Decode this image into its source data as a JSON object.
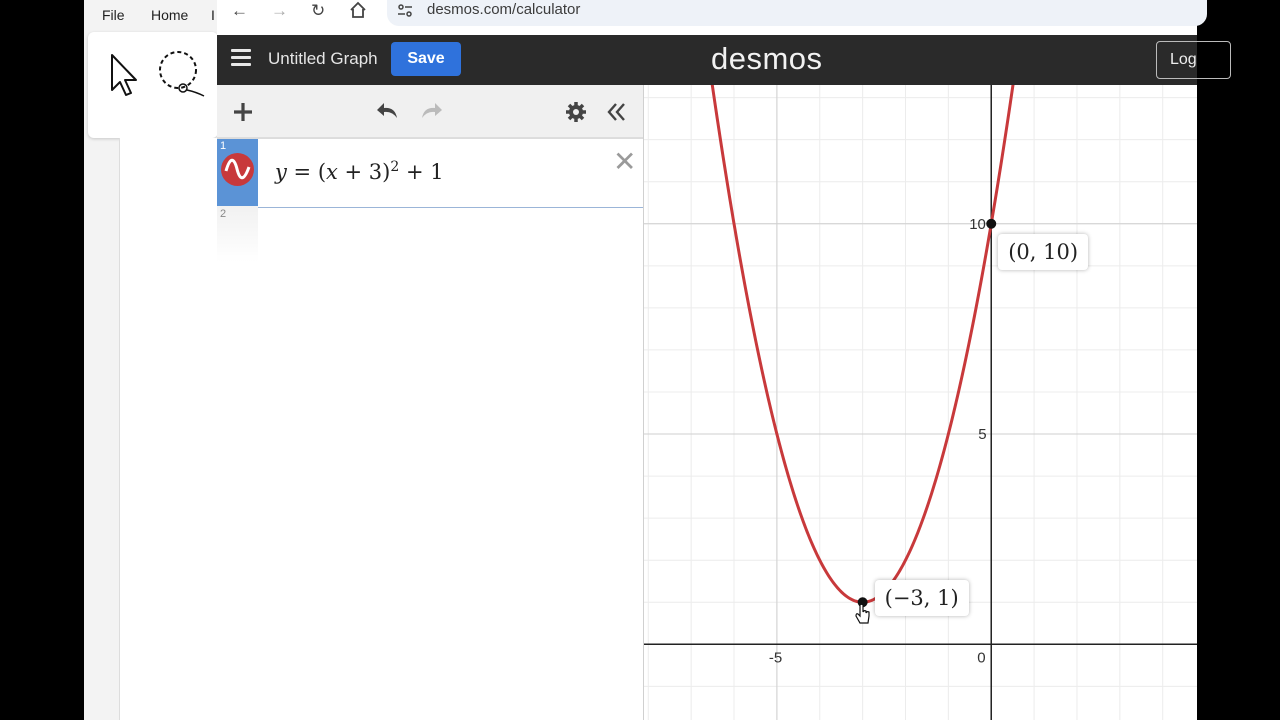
{
  "host": {
    "menu": [
      "File",
      "Home",
      "I"
    ]
  },
  "browser": {
    "url": "desmos.com/calculator"
  },
  "header": {
    "graph_title": "Untitled Graph",
    "save_label": "Save",
    "brand": "desmos",
    "login_label": "Log"
  },
  "expressions": [
    {
      "index": "1",
      "latex": "y = (x + 3)² + 1",
      "color": "#c8393b"
    },
    {
      "index": "2",
      "latex": ""
    }
  ],
  "graph": {
    "x_range": [
      -8.1,
      4.8
    ],
    "y_range": [
      -1.8,
      13.3
    ],
    "x_ticks": [
      {
        "value": -5,
        "label": "-5"
      },
      {
        "value": 0,
        "label": "0"
      }
    ],
    "y_ticks": [
      {
        "value": 5,
        "label": "5"
      },
      {
        "value": 10,
        "label": "10"
      }
    ],
    "curve": {
      "a": 1,
      "h": -3,
      "k": 1,
      "color": "#c8393b"
    },
    "points": [
      {
        "x": -3,
        "y": 1,
        "label": "(−3, 1)"
      },
      {
        "x": 0,
        "y": 10,
        "label": "(0, 10)"
      }
    ]
  }
}
